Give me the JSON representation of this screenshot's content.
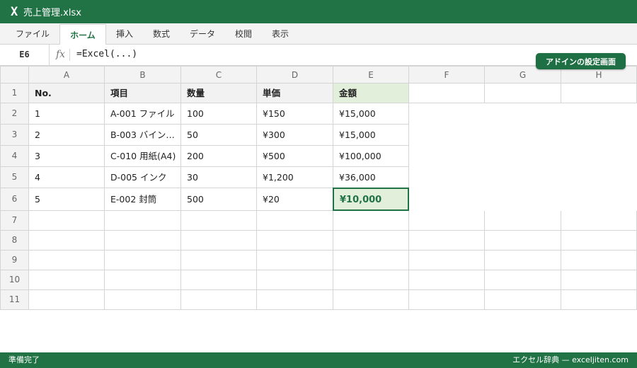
{
  "window": {
    "app_icon": "X",
    "title": "売上管理.xlsx"
  },
  "ribbon": {
    "tabs": [
      "ファイル",
      "ホーム",
      "挿入",
      "数式",
      "データ",
      "校閲",
      "表示"
    ],
    "active_tab": "ホーム"
  },
  "formula_bar": {
    "name_box": "E6",
    "fx_label": "fx",
    "formula": "=Excel(...)"
  },
  "addin_button": {
    "label": "アドインの設定画面"
  },
  "sheet": {
    "columns": [
      "A",
      "B",
      "C",
      "D",
      "E",
      "F",
      "G",
      "H"
    ],
    "row_numbers": [
      "1",
      "2",
      "3",
      "4",
      "5",
      "6",
      "7",
      "8",
      "9",
      "10",
      "11"
    ],
    "headers": [
      "No.",
      "項目",
      "数量",
      "単価",
      "金額"
    ],
    "rows": [
      [
        "1",
        "A-001 ファイル",
        "100",
        "¥150",
        "¥15,000"
      ],
      [
        "2",
        "B-003 バイン…",
        "50",
        "¥300",
        "¥15,000"
      ],
      [
        "3",
        "C-010 用紙(A4)",
        "200",
        "¥500",
        "¥100,000"
      ],
      [
        "4",
        "D-005 インク",
        "30",
        "¥1,200",
        "¥36,000"
      ],
      [
        "5",
        "E-002 封筒",
        "500",
        "¥20",
        "¥10,000"
      ]
    ],
    "selected_cell": "E6"
  },
  "status_bar": {
    "left": "準備完了",
    "right": "エクセル辞典 — exceljiten.com"
  },
  "colors": {
    "brand": "#217346",
    "selection_fill": "#e2efda",
    "grid_line": "#d4d4d4"
  }
}
